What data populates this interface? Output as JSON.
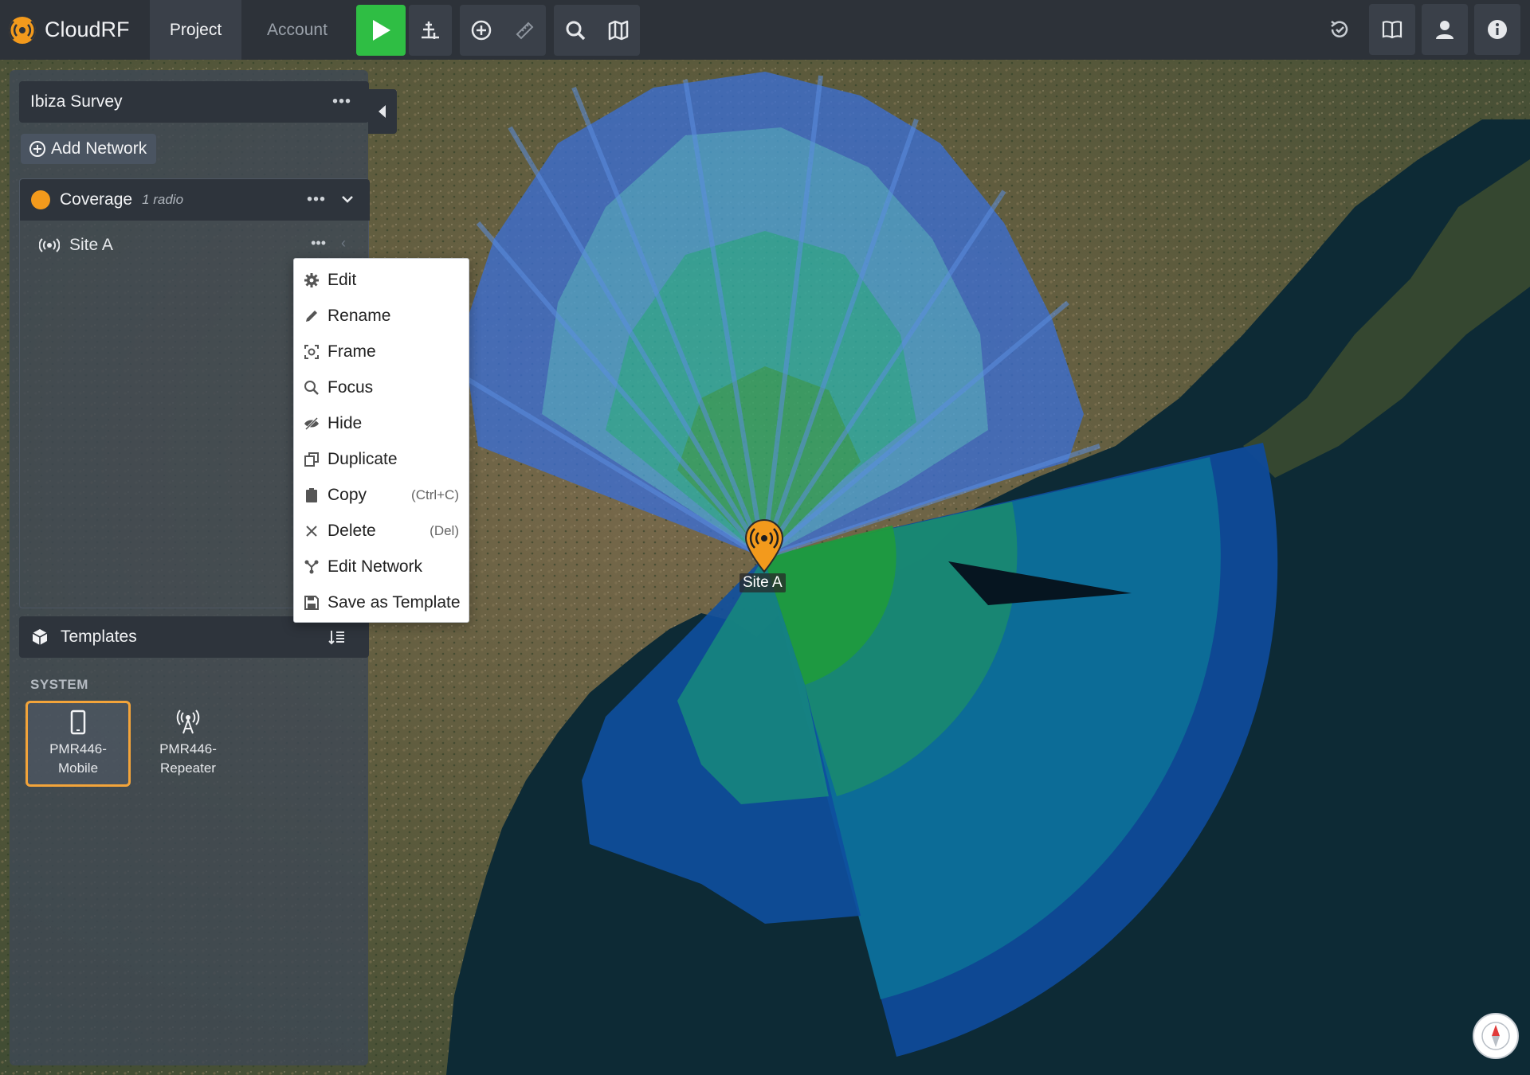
{
  "app": {
    "name": "CloudRF"
  },
  "nav": {
    "project": "Project",
    "account": "Account"
  },
  "toolbar": {
    "run": "play-icon",
    "icons": [
      "antenna-add-icon",
      "plus-circle-icon",
      "ruler-icon",
      "search-icon",
      "map-icon"
    ],
    "right_icons": [
      "history-icon",
      "book-icon",
      "user-icon",
      "info-icon"
    ]
  },
  "sidebar": {
    "project_name": "Ibiza Survey",
    "add_network": "Add Network",
    "network": {
      "name": "Coverage",
      "count": "1 radio",
      "color": "#f39a1c"
    },
    "site": {
      "name": "Site A"
    },
    "templates": {
      "title": "Templates",
      "section": "SYSTEM",
      "items": [
        {
          "line1": "PMR446-",
          "line2": "Mobile",
          "icon": "phone-icon",
          "selected": true
        },
        {
          "line1": "PMR446-",
          "line2": "Repeater",
          "icon": "tower-icon",
          "selected": false
        }
      ]
    }
  },
  "context_menu": {
    "items": [
      {
        "label": "Edit",
        "icon": "gear-icon",
        "shortcut": ""
      },
      {
        "label": "Rename",
        "icon": "pencil-icon",
        "shortcut": ""
      },
      {
        "label": "Frame",
        "icon": "frame-icon",
        "shortcut": ""
      },
      {
        "label": "Focus",
        "icon": "magnifier-icon",
        "shortcut": ""
      },
      {
        "label": "Hide",
        "icon": "eye-slash-icon",
        "shortcut": ""
      },
      {
        "label": "Duplicate",
        "icon": "duplicate-icon",
        "shortcut": ""
      },
      {
        "label": "Copy",
        "icon": "clipboard-icon",
        "shortcut": "(Ctrl+C)"
      },
      {
        "label": "Delete",
        "icon": "x-icon",
        "shortcut": "(Del)"
      },
      {
        "label": "Edit Network",
        "icon": "network-icon",
        "shortcut": ""
      },
      {
        "label": "Save as Template",
        "icon": "save-icon",
        "shortcut": ""
      }
    ]
  },
  "map": {
    "marker_label": "Site A"
  },
  "colors": {
    "accent": "#f39a1c",
    "run_green": "#2fbe44",
    "topbar": "#2d3239"
  }
}
